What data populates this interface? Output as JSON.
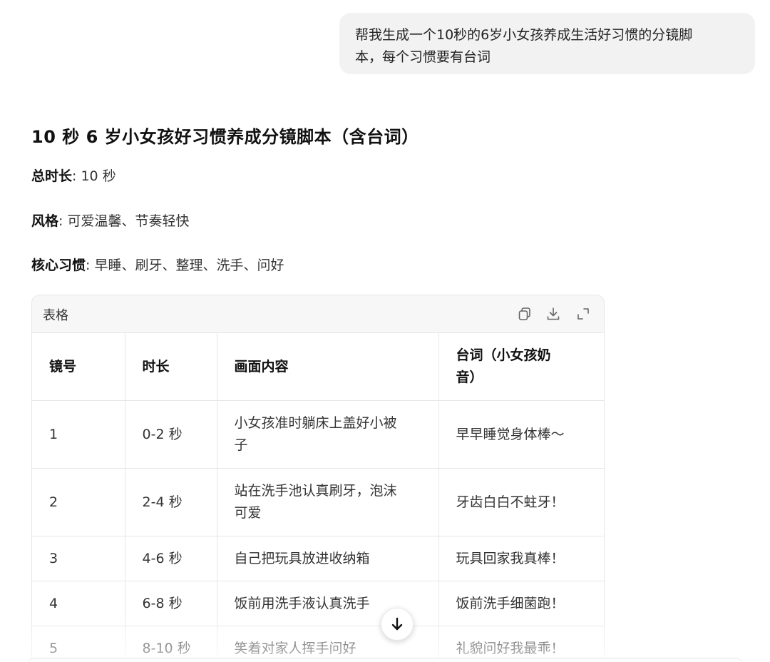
{
  "user_message": "帮我生成一个10秒的6岁小女孩养成生活好习惯的分镜脚本，每个习惯要有台词",
  "user_message_lines": [
    "帮我生成一个10秒的6岁小女孩养成生活好习惯的分镜脚",
    "本，每个习惯要有台词"
  ],
  "response": {
    "title": "10 秒 6 岁小女孩好习惯养成分镜脚本（含台词）",
    "meta": [
      {
        "key": "总时长",
        "sep": ":",
        "value": "10 秒"
      },
      {
        "key": "风格",
        "sep": ":",
        "value": "可爱温馨、节奏轻快"
      },
      {
        "key": "核心习惯",
        "sep": ":",
        "value": "早睡、刷牙、整理、洗手、问好"
      }
    ]
  },
  "table": {
    "label": "表格",
    "toolbar": {
      "copy_icon": "copy-icon",
      "download_icon": "download-icon",
      "expand_icon": "expand-icon"
    },
    "columns": [
      "镜号",
      "时长",
      "画面内容",
      "台词（小女孩奶音）"
    ],
    "column_lines": {
      "dialogue": [
        "台词（小女孩奶",
        "音）"
      ]
    },
    "rows": [
      {
        "shot": "1",
        "duration": "0-2 秒",
        "scene": "小女孩准时躺床上盖好小被子",
        "scene_lines": [
          "小女孩准时躺床上盖好小被",
          "子"
        ],
        "dialogue": "早早睡觉身体棒～"
      },
      {
        "shot": "2",
        "duration": "2-4 秒",
        "scene": "站在洗手池认真刷牙，泡沫可爱",
        "scene_lines": [
          "站在洗手池认真刷牙，泡沫",
          "可爱"
        ],
        "dialogue": "牙齿白白不蛀牙！"
      },
      {
        "shot": "3",
        "duration": "4-6 秒",
        "scene": "自己把玩具放进收纳箱",
        "dialogue": "玩具回家我真棒！"
      },
      {
        "shot": "4",
        "duration": "6-8 秒",
        "scene": "饭前用洗手液认真洗手",
        "dialogue": "饭前洗手细菌跑！"
      },
      {
        "shot": "5",
        "duration": "8-10 秒",
        "scene": "笑着对家人挥手问好",
        "dialogue": "礼貌问好我最乖！"
      }
    ]
  },
  "scroll_button_icon": "arrow-down-icon"
}
